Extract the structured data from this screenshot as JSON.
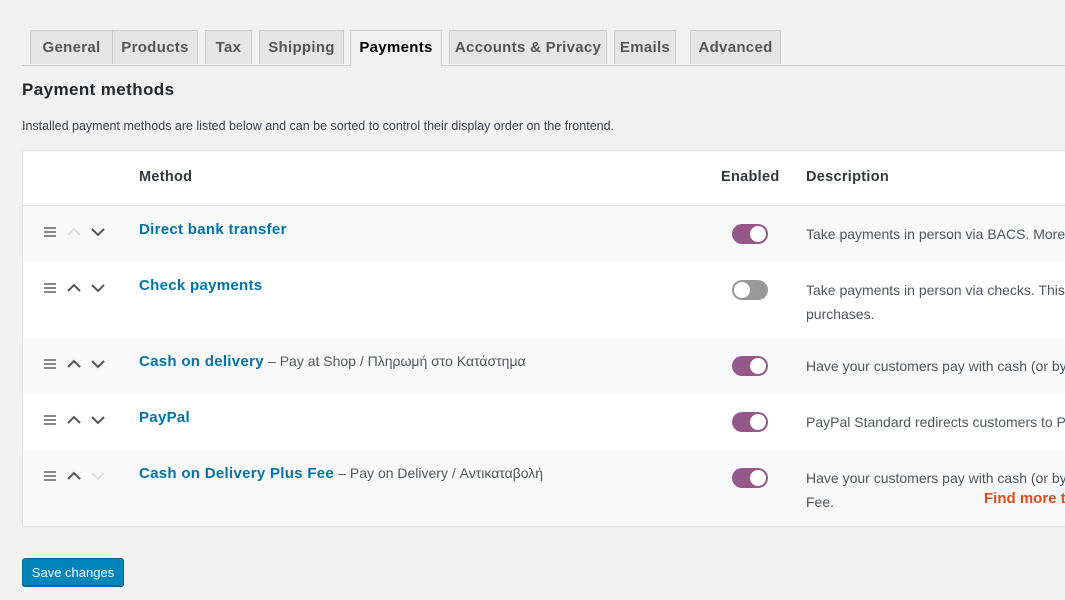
{
  "tabs": [
    {
      "label": "General",
      "active": false
    },
    {
      "label": "Products",
      "active": false
    },
    {
      "label": "Tax",
      "active": false
    },
    {
      "label": "Shipping",
      "active": false
    },
    {
      "label": "Payments",
      "active": true
    },
    {
      "label": "Accounts & Privacy",
      "active": false
    },
    {
      "label": "Emails",
      "active": false
    },
    {
      "label": "Advanced",
      "active": false
    }
  ],
  "section": {
    "title": "Payment methods",
    "intro": "Installed payment methods are listed below and can be sorted to control their display order on the frontend."
  },
  "table": {
    "columns": {
      "method": "Method",
      "enabled": "Enabled",
      "description": "Description"
    },
    "rows": [
      {
        "name": "Direct bank transfer",
        "subtitle": "",
        "enabled": true,
        "move_up_enabled": false,
        "move_down_enabled": true,
        "description": "Take payments in person via BACS. More c",
        "description_line2": "",
        "find_more": ""
      },
      {
        "name": "Check payments",
        "subtitle": "",
        "enabled": false,
        "move_up_enabled": true,
        "move_down_enabled": true,
        "description": "Take payments in person via checks. This c",
        "description_line2": "purchases.",
        "find_more": ""
      },
      {
        "name": "Cash on delivery",
        "subtitle": "– Pay at Shop / Πληρωμή στο Κατάστημα",
        "enabled": true,
        "move_up_enabled": true,
        "move_down_enabled": true,
        "description": "Have your customers pay with cash (or by",
        "description_line2": "",
        "find_more": ""
      },
      {
        "name": "PayPal",
        "subtitle": "",
        "enabled": true,
        "move_up_enabled": true,
        "move_down_enabled": true,
        "description": "PayPal Standard redirects customers to P",
        "description_line2": "",
        "find_more": ""
      },
      {
        "name": "Cash on Delivery Plus Fee",
        "subtitle": "– Pay on Delivery / Αντικαταβολή",
        "enabled": true,
        "move_up_enabled": true,
        "move_down_enabled": false,
        "description": "Have your customers pay with cash (or by",
        "description_line2": "Fee.",
        "find_more": "Find more th"
      }
    ]
  },
  "colors": {
    "accent": "#96588a",
    "toggle_off": "#999999",
    "link": "#0073aa",
    "find_more": "#d54e21",
    "primary_button": "#0085ba"
  },
  "save_button": {
    "label": "Save changes"
  }
}
